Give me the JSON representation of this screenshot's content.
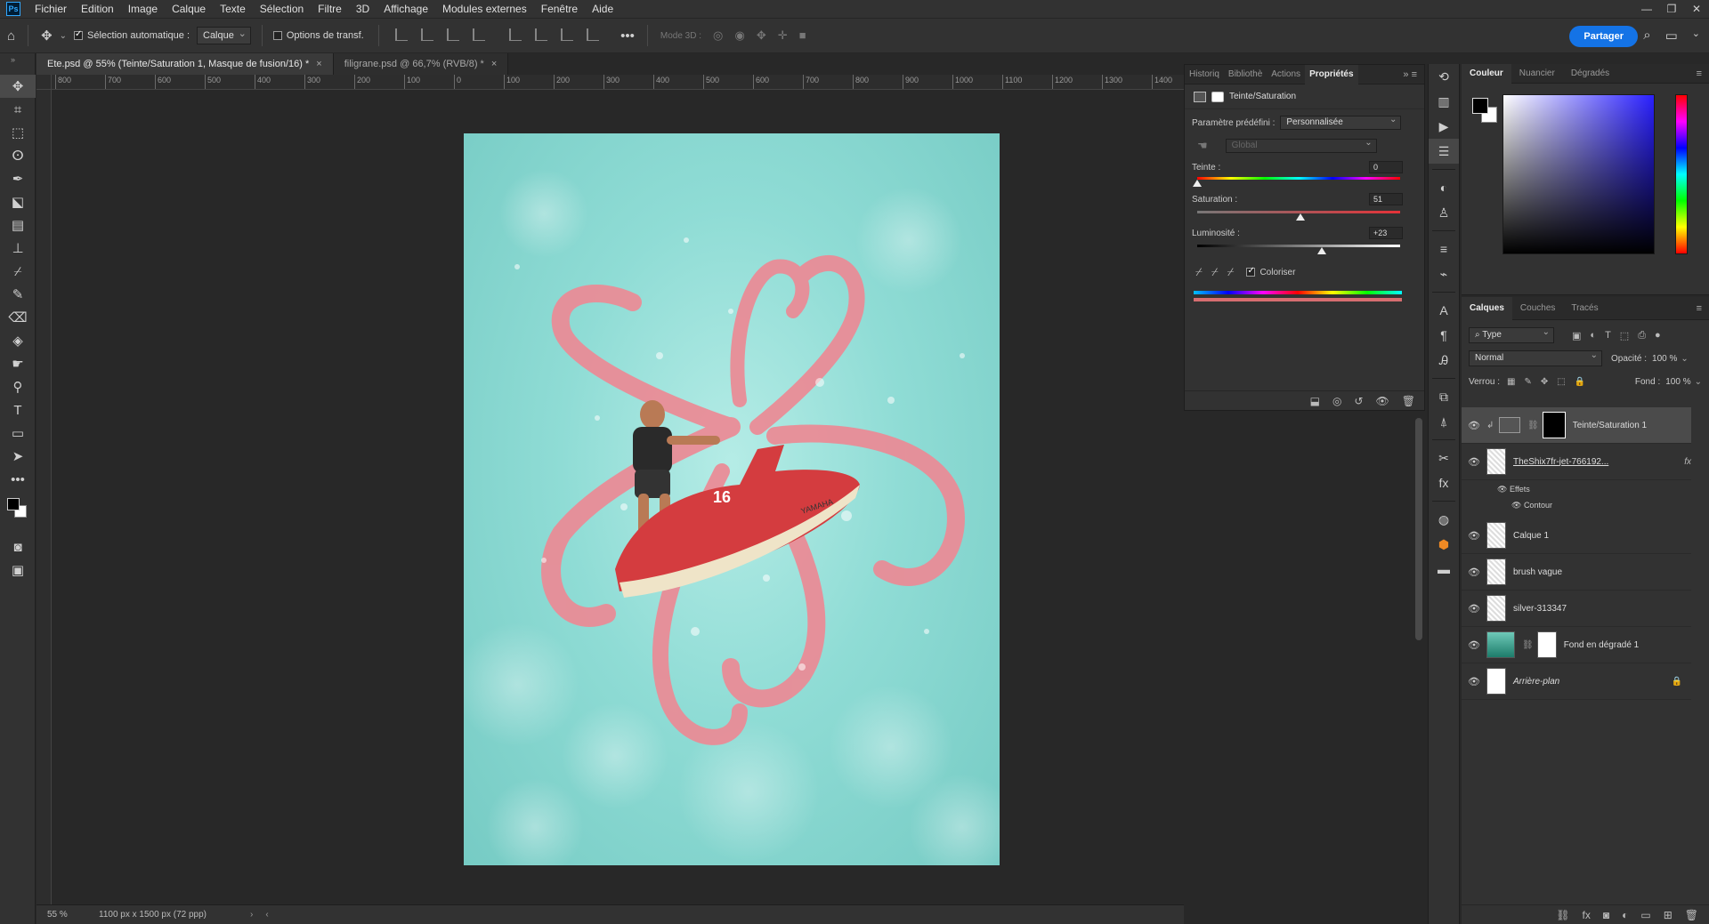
{
  "menu": {
    "items": [
      "Fichier",
      "Edition",
      "Image",
      "Calque",
      "Texte",
      "Sélection",
      "Filtre",
      "3D",
      "Affichage",
      "Modules externes",
      "Fenêtre",
      "Aide"
    ]
  },
  "options": {
    "auto_select_label": "Sélection automatique :",
    "auto_select_value": "Calque",
    "transform_label": "Options de transf.",
    "mode3d_label": "Mode 3D :",
    "share_label": "Partager"
  },
  "tabs": [
    {
      "label": "Ete.psd @ 55% (Teinte/Saturation 1, Masque de fusion/16) *",
      "active": true
    },
    {
      "label": "filigrane.psd @ 66,7% (RVB/8) *",
      "active": false
    }
  ],
  "ruler": {
    "ticks": [
      "800",
      "700",
      "600",
      "500",
      "400",
      "300",
      "200",
      "100",
      "0",
      "100",
      "200",
      "300",
      "400",
      "500",
      "600",
      "700",
      "800",
      "900",
      "1000",
      "1100",
      "1200",
      "1300",
      "1400"
    ]
  },
  "status": {
    "zoom": "55 %",
    "doc_info": "1100 px x 1500 px (72 ppp)"
  },
  "properties": {
    "tabs": [
      "Historiq",
      "Bibliothè",
      "Actions",
      "Propriétés"
    ],
    "active_tab": "Propriétés",
    "title": "Teinte/Saturation",
    "preset_label": "Paramètre prédéfini :",
    "preset_value": "Personnalisée",
    "range_value": "Global",
    "hue_label": "Teinte :",
    "hue_value": "0",
    "saturation_label": "Saturation :",
    "saturation_value": "51",
    "lightness_label": "Luminosité :",
    "lightness_value": "+23",
    "colorize_label": "Coloriser",
    "colorize_checked": true
  },
  "color_panel": {
    "tabs": [
      "Couleur",
      "Nuancier",
      "Dégradés"
    ],
    "active_tab": "Couleur",
    "foreground": "#000000",
    "background": "#ffffff"
  },
  "layers_panel": {
    "tabs": [
      "Calques",
      "Couches",
      "Tracés"
    ],
    "active_tab": "Calques",
    "filter_label": "Type",
    "blend_mode": "Normal",
    "opacity_label": "Opacité :",
    "opacity_value": "100 %",
    "lock_label": "Verrou :",
    "fill_label": "Fond :",
    "fill_value": "100 %",
    "effects_label": "Effets",
    "contour_label": "Contour",
    "layers": [
      {
        "name": "Teinte/Saturation 1",
        "selected": true
      },
      {
        "name": "TheShix7fr-jet-766192...",
        "fx": "fx"
      },
      {
        "name": "Calque 1"
      },
      {
        "name": "brush vague"
      },
      {
        "name": "silver-313347"
      },
      {
        "name": "Fond en dégradé 1"
      },
      {
        "name": "Arrière-plan",
        "locked": true
      }
    ]
  },
  "artwork": {
    "jetski_number": "16",
    "jetski_brand": "YAMAHA"
  }
}
